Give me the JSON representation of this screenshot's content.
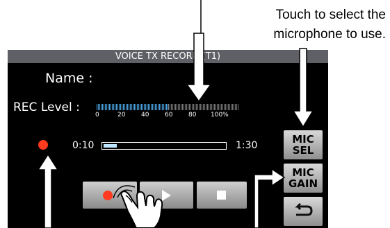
{
  "callout": {
    "line1": "Touch to select the",
    "line2": "microphone to use."
  },
  "screen": {
    "title": "VOICE TX RECORD (T1)",
    "name_label": "Name :",
    "rec_level_label": "REC Level :",
    "rec_level_ticks": [
      "0",
      "20",
      "40",
      "60",
      "80",
      "100%"
    ],
    "rec_level_fraction": 0.5,
    "elapsed_time": "0:10",
    "total_time": "1:30",
    "progress_fraction": 0.11,
    "record_indicator_color": "#ff3a1e"
  },
  "controls": {
    "record_icon": "record-icon",
    "play_icon": "play-icon",
    "stop_icon": "stop-icon",
    "back_icon": "return-icon"
  },
  "side_buttons": {
    "mic_sel_line1": "MIC",
    "mic_sel_line2": "SEL",
    "mic_gain_line1": "MIC",
    "mic_gain_line2": "GAIN"
  },
  "colors": {
    "meter": "#4aa3e0",
    "record": "#ff3a1e",
    "titlebar": "#5f6066"
  }
}
